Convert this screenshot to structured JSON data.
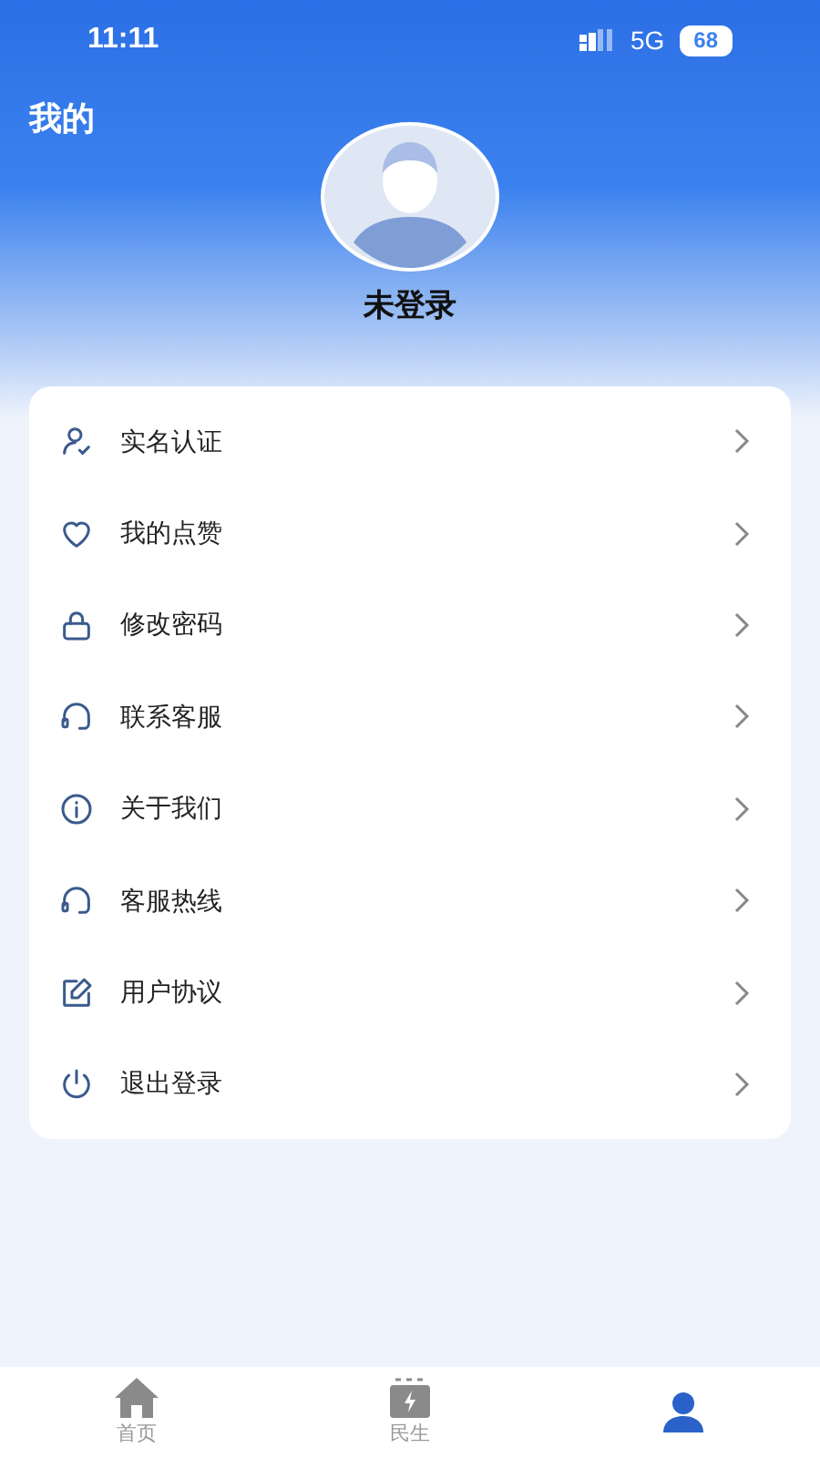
{
  "status_bar": {
    "time": "11:11",
    "network": "5G",
    "battery": "68"
  },
  "header": {
    "title": "我的"
  },
  "profile": {
    "name": "未登录"
  },
  "menu": [
    {
      "kind": "user-check",
      "label": "实名认证"
    },
    {
      "kind": "heart",
      "label": "我的点赞"
    },
    {
      "kind": "lock",
      "label": "修改密码"
    },
    {
      "kind": "headset",
      "label": "联系客服"
    },
    {
      "kind": "info",
      "label": "关于我们"
    },
    {
      "kind": "headset",
      "label": "客服热线"
    },
    {
      "kind": "edit",
      "label": "用户协议"
    },
    {
      "kind": "power",
      "label": "退出登录"
    }
  ],
  "tabs": [
    {
      "kind": "home",
      "label": "首页",
      "selected": false
    },
    {
      "kind": "bolt",
      "label": "民生",
      "selected": false
    },
    {
      "kind": "person",
      "selected": true
    }
  ]
}
